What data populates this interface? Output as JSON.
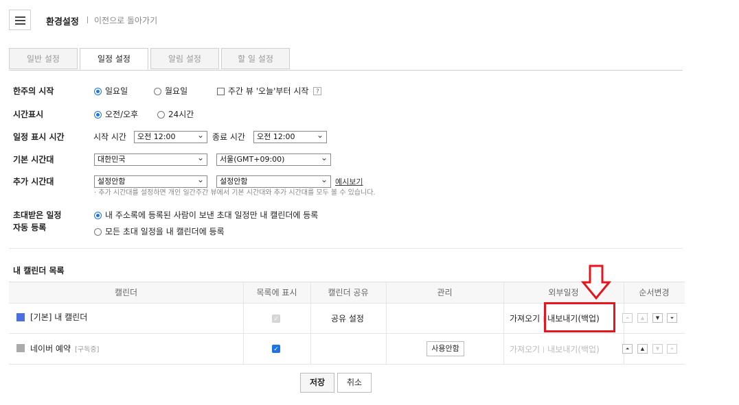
{
  "header": {
    "title": "환경설정",
    "back_link": "이전으로 돌아가기"
  },
  "tabs": [
    {
      "label": "일반 설정",
      "active": false
    },
    {
      "label": "일정 설정",
      "active": true
    },
    {
      "label": "알림 설정",
      "active": false
    },
    {
      "label": "할 일 설정",
      "active": false
    }
  ],
  "settings": {
    "week_start": {
      "label": "한주의 시작",
      "options": [
        "일요일",
        "월요일"
      ],
      "selected": "일요일",
      "weekly_view_label": "주간 뷰 '오늘'부터 시작",
      "weekly_view_checked": false,
      "help": "?"
    },
    "time_display": {
      "label": "시간표시",
      "options": [
        "오전/오후",
        "24시간"
      ],
      "selected": "오전/오후"
    },
    "display_time": {
      "label": "일정 표시 시간",
      "start_label": "시작 시간",
      "start_value": "오전 12:00",
      "end_label": "종료 시간",
      "end_value": "오전 12:00"
    },
    "base_timezone": {
      "label": "기본 시간대",
      "country": "대한민국",
      "zone": "서울(GMT+09:00)"
    },
    "extra_timezone": {
      "label": "추가 시간대",
      "country": "설정안함",
      "zone": "설정안함",
      "example_link": "예시보기",
      "note": "· 추가 시간대를 설정하면 개인 일간주간 뷰에서 기본 시간대와 추가 시간대를 모두 볼 수 있습니다."
    },
    "invites": {
      "label_line1": "초대받은 일정",
      "label_line2": "자동 등록",
      "options": [
        "내 주소록에 등록된 사람이 보낸 초대 일정만 내 캘린더에 등록",
        "모든 초대 일정을 내 캘린더에 등록"
      ],
      "selected_index": 0
    }
  },
  "calendar_list": {
    "title": "내 캘린더 목록",
    "columns": [
      "캘린더",
      "목록에 표시",
      "캘린더 공유",
      "관리",
      "외부일정",
      "순서변경"
    ],
    "rows": [
      {
        "name": "[기본] 내 캘린더",
        "sub": "",
        "color": "#4a6fe3",
        "shown": true,
        "shown_disabled": true,
        "share": "공유 설정",
        "manage": "",
        "import": "가져오기",
        "export": "내보내기(백업)",
        "external_enabled": true
      },
      {
        "name": "네이버 예약",
        "sub": "[구독중]",
        "color": "#aaaaaa",
        "shown": true,
        "shown_disabled": false,
        "share": "",
        "manage": "사용안함",
        "import": "가져오기",
        "export": "내보내기(백업)",
        "external_enabled": false
      }
    ],
    "order_icons": [
      "move-top-icon",
      "move-up-icon",
      "move-down-icon",
      "move-bottom-icon"
    ]
  },
  "footer": {
    "save": "저장",
    "cancel": "취소"
  },
  "colors": {
    "accent": "#1a73e8",
    "highlight": "#e8141c"
  }
}
